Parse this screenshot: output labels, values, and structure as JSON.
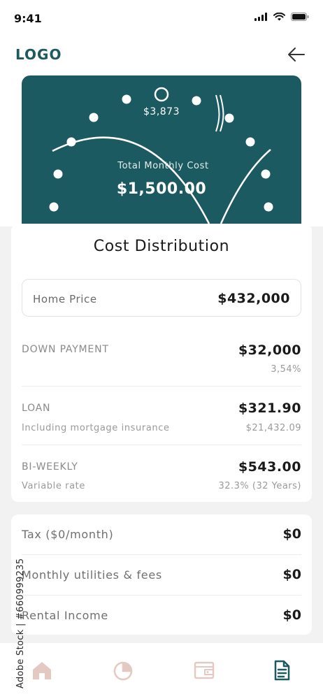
{
  "status": {
    "time": "9:41"
  },
  "header": {
    "logo": "LOGO"
  },
  "hero": {
    "top_value": "$3,873",
    "label": "Total Monthly Cost",
    "value": "$1,500.00"
  },
  "distribution": {
    "title": "Cost Distribution",
    "home_price": {
      "label": "Home Price",
      "value": "$432,000"
    },
    "rows": [
      {
        "label": "DOWN PAYMENT",
        "sub": "",
        "value": "$32,000",
        "meta": "3,54%"
      },
      {
        "label": "LOAN",
        "sub": "Including mortgage insurance",
        "value": "$321.90",
        "meta": "$21,432.09"
      },
      {
        "label": "BI-WEEKLY",
        "sub": "Variable rate",
        "value": "$543.00",
        "meta": "32.3% (32 Years)"
      }
    ]
  },
  "extras": [
    {
      "label": "Tax ($0/month)",
      "value": "$0"
    },
    {
      "label": "Monthly utilities & fees",
      "value": "$0"
    },
    {
      "label": "Rental Income",
      "value": "$0"
    }
  ],
  "nav": {
    "items": [
      {
        "icon": "home-icon",
        "active": false
      },
      {
        "icon": "pie-chart-icon",
        "active": false
      },
      {
        "icon": "wallet-icon",
        "active": false
      },
      {
        "icon": "document-icon",
        "active": true
      }
    ]
  },
  "watermark_side": "Adobe Stock | #660999235",
  "colors": {
    "brand": "#1b5a61",
    "nav_inactive": "#e3c9c2",
    "nav_active": "#1d5a60"
  }
}
